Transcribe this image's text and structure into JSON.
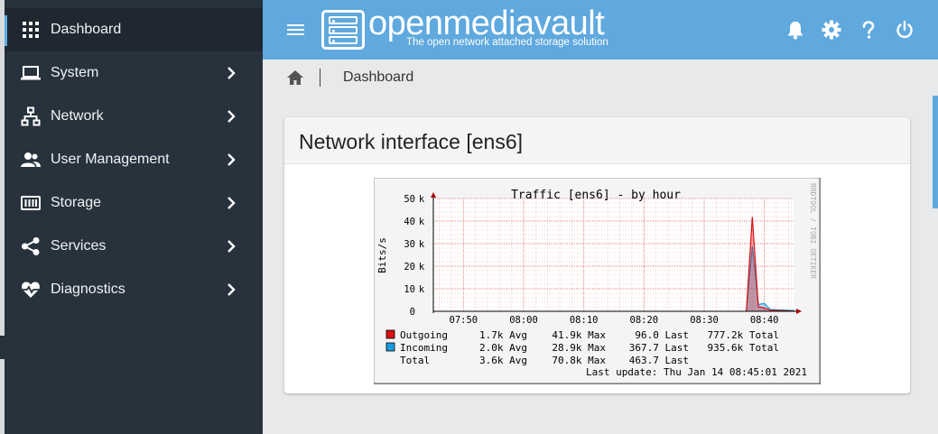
{
  "sidebar": {
    "items": [
      {
        "label": "Dashboard",
        "icon": "dashboard-grid-icon",
        "active": true
      },
      {
        "label": "System",
        "icon": "laptop-icon"
      },
      {
        "label": "Network",
        "icon": "network-icon"
      },
      {
        "label": "User Management",
        "icon": "users-icon"
      },
      {
        "label": "Storage",
        "icon": "storage-icon"
      },
      {
        "label": "Services",
        "icon": "share-icon"
      },
      {
        "label": "Diagnostics",
        "icon": "heart-pulse-icon"
      }
    ]
  },
  "header": {
    "brand": "openmediavault",
    "tagline": "The open network attached storage solution",
    "icons": [
      "bell-icon",
      "gear-icon",
      "help-icon",
      "power-icon"
    ]
  },
  "breadcrumb": {
    "current": "Dashboard"
  },
  "card": {
    "title": "Network interface [ens6]"
  },
  "chart_data": {
    "type": "line",
    "title": "Traffic [ens6] - by hour",
    "ylabel": "Bits/s",
    "watermark": "RRDTOOL / TOBI OETIKER",
    "y_ticks": [
      "0",
      "10 k",
      "20 k",
      "30 k",
      "40 k",
      "50 k"
    ],
    "x_ticks": [
      "07:50",
      "08:00",
      "08:10",
      "08:20",
      "08:30",
      "08:40"
    ],
    "ylim": [
      0,
      50000
    ],
    "xlim": [
      "07:45",
      "08:45"
    ],
    "series": [
      {
        "name": "Outgoing",
        "color": "#dd1111",
        "x": [
          "08:37",
          "08:38",
          "08:39",
          "08:40",
          "08:41",
          "08:45"
        ],
        "values": [
          0,
          41900,
          2000,
          1500,
          500,
          96
        ]
      },
      {
        "name": "Incoming",
        "color": "#1b9be0",
        "x": [
          "08:37",
          "08:38",
          "08:39",
          "08:40",
          "08:41",
          "08:45"
        ],
        "values": [
          0,
          28900,
          3000,
          3500,
          800,
          368
        ]
      }
    ],
    "legend_rows": [
      {
        "name": "Outgoing",
        "avg": "1.7k Avg",
        "max": "41.9k Max",
        "last": "96.0  Last",
        "total": "777.2k Total",
        "color": "#dd1111"
      },
      {
        "name": "Incoming",
        "avg": "2.0k Avg",
        "max": "28.9k Max",
        "last": "367.7  Last",
        "total": "935.6k Total",
        "color": "#1b9be0"
      },
      {
        "name": "Total",
        "avg": "3.6k Avg",
        "max": "70.8k Max",
        "last": "463.7  Last",
        "total": "",
        "color": ""
      }
    ],
    "last_update": "Last update: Thu Jan 14 08:45:01 2021"
  }
}
